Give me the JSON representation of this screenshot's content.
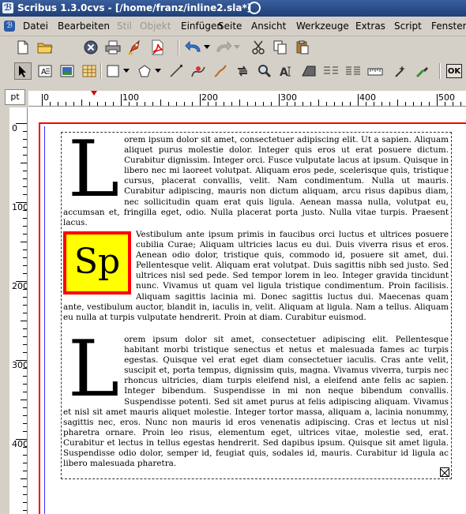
{
  "window": {
    "title": "Scribus 1.3.0cvs - [/home/franz/inline2.sla*]"
  },
  "menu": {
    "items": [
      "Datei",
      "Bearbeiten",
      "Stil",
      "Objekt",
      "Einfügen",
      "Seite",
      "Ansicht",
      "Werkzeuge",
      "Extras",
      "Script",
      "Fenster"
    ],
    "disabled": [
      "Stil",
      "Objekt"
    ]
  },
  "toolbar1": {
    "icons": [
      "new-document-icon",
      "open-folder-icon",
      "close-icon",
      "print-icon",
      "preflight-rocket-icon",
      "export-pdf-icon",
      "undo-icon",
      "redo-icon",
      "cut-icon",
      "copy-icon",
      "paste-icon"
    ]
  },
  "toolbar2": {
    "icons": [
      "select-arrow-icon",
      "text-frame-icon",
      "image-frame-icon",
      "table-icon",
      "shape-icon",
      "polygon-icon",
      "line-icon",
      "bezier-icon",
      "freehand-icon",
      "rotate-icon",
      "zoom-icon",
      "edit-text-icon",
      "link-frames-icon",
      "unlink-frames-icon",
      "measure-icon",
      "copy-properties-icon",
      "eyedropper-icon"
    ],
    "ok_label": "OK"
  },
  "ruler": {
    "unit": "pt",
    "h_labels": [
      "0",
      "100",
      "200",
      "300",
      "400",
      "500"
    ],
    "v_labels": [
      "0",
      "100",
      "200",
      "300",
      "400"
    ]
  },
  "document": {
    "para1_dropcap": "L",
    "para1_text": "orem ipsum dolor sit amet, consectetuer adipiscing elit. Ut a sapien. Aliquam aliquet purus molestie dolor. Integer quis eros ut erat posuere dictum. Curabitur dignissim. Integer orci. Fusce vulputate lacus at ipsum. Quisque in libero nec mi laoreet volutpat. Aliquam eros pede, scelerisque quis, tristique cursus, placerat convallis, velit. Nam condimentum. Nulla ut mauris. Curabitur adipiscing, mauris non dictum aliquam, arcu risus dapibus diam, nec sollicitudin quam erat quis ligula. Aenean massa nulla, volutpat eu, accumsan et, fringilla eget, odio. Nulla placerat porta justo. Nulla vitae turpis. Praesent lacus.",
    "inline_box_text": "Sp",
    "para2_text": "Vestibulum ante ipsum primis in faucibus orci luctus et ultrices posuere cubilia Curae; Aliquam ultricies lacus eu dui. Duis viverra risus et eros. Aenean odio dolor, tristique quis, commodo id, posuere sit amet, dui. Pellentesque velit. Aliquam erat volutpat. Duis sagittis nibh sed justo. Sed ultrices nisl sed pede. Sed tempor lorem in leo. Integer gravida tincidunt nunc. Vivamus ut quam vel ligula tristique condimentum. Proin facilisis. Aliquam sagittis lacinia mi. Donec sagittis luctus dui. Maecenas quam ante, vestibulum auctor, blandit in, iaculis in, velit. Aliquam at ligula. Nam a tellus. Aliquam eu nulla at turpis vulputate hendrerit. Proin at diam. Curabitur euismod.",
    "para3_dropcap": "L",
    "para3_text": "orem ipsum dolor sit amet, consectetuer adipiscing elit. Pellentesque habitant morbi tristique senectus et netus et malesuada fames ac turpis egestas. Quisque vel erat eget diam consectetuer iaculis. Cras ante velit, suscipit et, porta tempus, dignissim quis, magna. Vivamus viverra, turpis nec rhoncus ultricies, diam turpis eleifend nisl, a eleifend ante felis ac sapien. Integer bibendum. Suspendisse in mi non neque bibendum convallis. Suspendisse potenti. Sed sit amet purus at felis adipiscing aliquam. Vivamus et nisl sit amet mauris aliquet molestie. Integer tortor massa, aliquam a, lacinia nonummy, sagittis nec, eros. Nunc non mauris id eros venenatis adipiscing. Cras et lectus ut nisl pharetra ornare. Proin leo risus, elementum eget, ultrices vitae, molestie sed, erat. Curabitur et lectus in tellus egestas hendrerit. Sed dapibus ipsum. Quisque sit amet ligula. Suspendisse odio dolor, semper id, feugiat quis, sodales id, mauris. Curabitur id ligula ac libero malesuada pharetra."
  },
  "colors": {
    "margin_guide": "#ff0000",
    "page_border": "#3030ff",
    "inline_fill": "#ffff00",
    "inline_stroke": "#ff0000"
  }
}
